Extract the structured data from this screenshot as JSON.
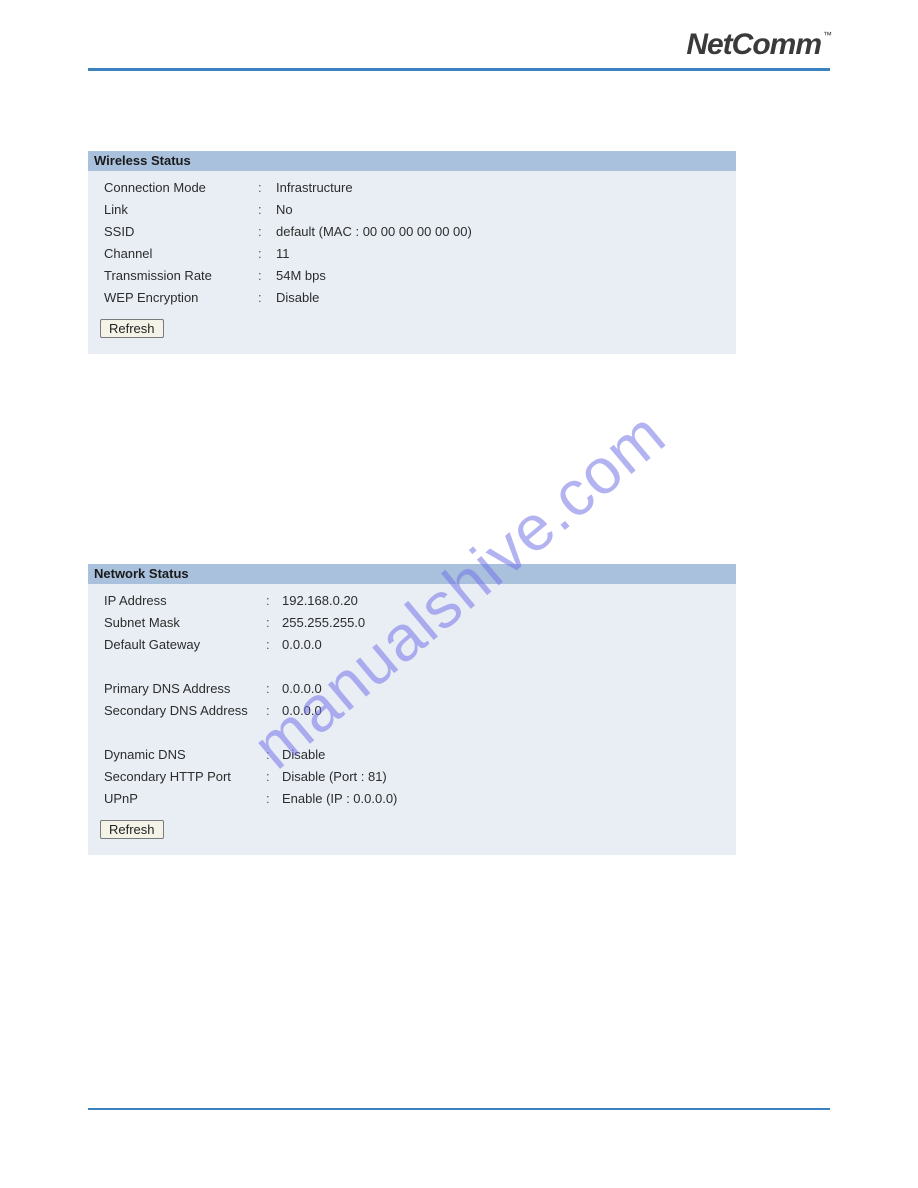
{
  "brand": {
    "name": "NetComm",
    "tm": "™"
  },
  "watermark": "manualshive.com",
  "wireless": {
    "title": "Wireless Status",
    "refresh_label": "Refresh",
    "rows": [
      {
        "label": "Connection Mode",
        "value": "Infrastructure"
      },
      {
        "label": "Link",
        "value": "No"
      },
      {
        "label": "SSID",
        "value": "default (MAC : 00 00 00 00 00 00)"
      },
      {
        "label": "Channel",
        "value": "11"
      },
      {
        "label": "Transmission Rate",
        "value": "54M bps"
      },
      {
        "label": "WEP Encryption",
        "value": "Disable"
      }
    ]
  },
  "network": {
    "title": "Network Status",
    "refresh_label": "Refresh",
    "rows1": [
      {
        "label": "IP Address",
        "value": "192.168.0.20"
      },
      {
        "label": "Subnet Mask",
        "value": "255.255.255.0"
      },
      {
        "label": "Default Gateway",
        "value": "0.0.0.0"
      }
    ],
    "rows2": [
      {
        "label": "Primary DNS Address",
        "value": "0.0.0.0"
      },
      {
        "label": "Secondary DNS Address",
        "value": "0.0.0.0"
      }
    ],
    "rows3": [
      {
        "label": "Dynamic DNS",
        "value": "Disable"
      },
      {
        "label": "Secondary HTTP Port",
        "value": "Disable (Port : 81)"
      },
      {
        "label": "UPnP",
        "value": "Enable (IP : 0.0.0.0)"
      }
    ]
  }
}
